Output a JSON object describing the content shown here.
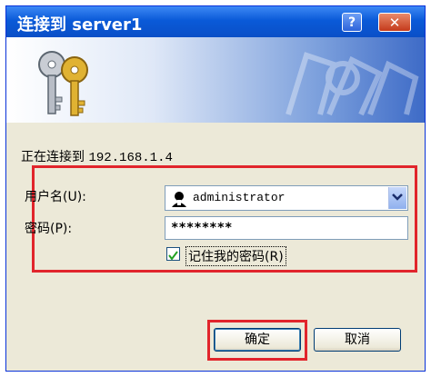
{
  "window": {
    "title": "连接到 server1",
    "help_label": "?",
    "close_label": "✕"
  },
  "dialog": {
    "connecting_label": "正在连接到",
    "connecting_ip": "192.168.1.4",
    "username_label": "用户名(U):",
    "username_value": "administrator",
    "password_label": "密码(P):",
    "password_value": "********",
    "remember_label": "记住我的密码(R)",
    "remember_checked": true,
    "ok_label": "确定",
    "cancel_label": "取消"
  },
  "colors": {
    "titlebar": "#0a5ad8",
    "highlight_box": "#e1252c",
    "dialog_bg": "#ece9d8"
  },
  "icons": {
    "banner": "keys-icon",
    "user": "user-icon",
    "dropdown": "chevron-down-icon",
    "check": "check-icon"
  }
}
